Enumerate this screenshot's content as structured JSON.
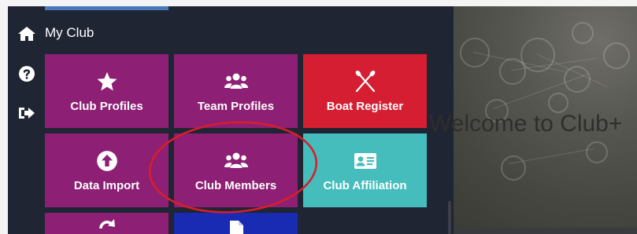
{
  "header": {
    "title": "My Club"
  },
  "tiles": [
    {
      "label": "Club Profiles",
      "icon": "star-icon",
      "color": "#8d1f74"
    },
    {
      "label": "Team Profiles",
      "icon": "users-icon",
      "color": "#8d1f74"
    },
    {
      "label": "Boat Register",
      "icon": "crossed-oars-icon",
      "color": "#d51e32"
    },
    {
      "label": "Data Import",
      "icon": "upload-circle-icon",
      "color": "#8d1f74"
    },
    {
      "label": "Club Members",
      "icon": "users-icon",
      "color": "#8d1f74"
    },
    {
      "label": "Club Affiliation",
      "icon": "id-card-icon",
      "color": "#45bdbd"
    }
  ],
  "background": {
    "welcome_text": "Welcome to Club+"
  },
  "colors": {
    "panel": "#1f2533",
    "tile_purple": "#8d1f74",
    "tile_red": "#d51e32",
    "tile_teal": "#45bdbd",
    "tile_navy": "#1a2bb3",
    "annotation": "#d81e2a"
  }
}
